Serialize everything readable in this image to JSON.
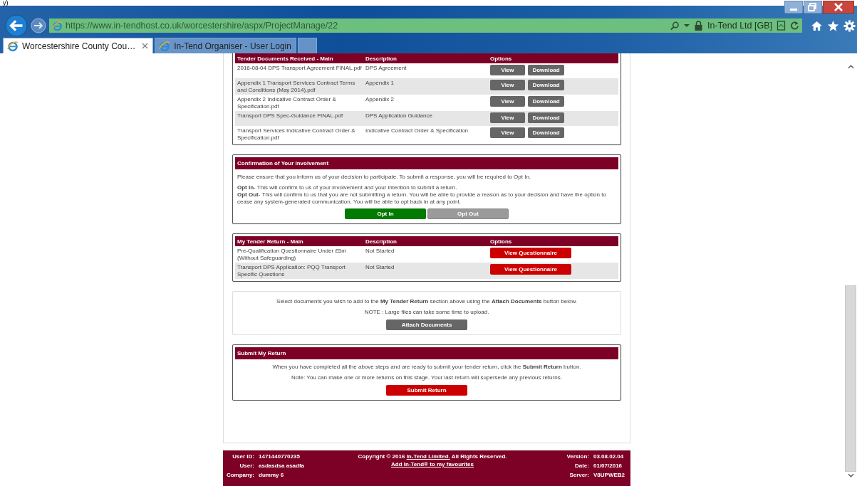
{
  "top_fragment": "y)",
  "browser": {
    "address": "https://www.in-tendhost.co.uk/worcestershire/aspx/ProjectManage/22",
    "site_identity": "In-Tend Ltd [GB]",
    "tabs": [
      {
        "title": "Worcestershire County Cou…",
        "selected": true
      },
      {
        "title": "In-Tend Organiser - User Login",
        "selected": false
      }
    ]
  },
  "documents": {
    "columns": [
      "Tender Documents Received - Main",
      "Description",
      "Options"
    ],
    "rows": [
      {
        "name": "2016-08-04 DPS Transport Agreement FINAL.pdf",
        "description": "DPS Agreement",
        "actions": [
          "View",
          "Download"
        ]
      },
      {
        "name": "Appendix 1 Transport Services Contract Terms and Conditions (May 2014).pdf",
        "description": "Appendix 1",
        "actions": [
          "View",
          "Download"
        ]
      },
      {
        "name": "Appendix 2 Indicative Contract Order & Specification.pdf",
        "description": "Appendix 2",
        "actions": [
          "View",
          "Download"
        ]
      },
      {
        "name": "Transport DPS Spec-Guidance FINAL.pdf",
        "description": "DPS Application Guidance",
        "actions": [
          "View",
          "Download"
        ]
      },
      {
        "name": "Transport Services Indicative Contract Order & Specification.pdf",
        "description": "Indicative Contract Order & Specification",
        "actions": [
          "View",
          "Download"
        ]
      }
    ]
  },
  "confirmation": {
    "title": "Confirmation of Your Involvement",
    "intro": "Please ensure that you inform us of your decision to participate. To submit a response, you will be required to Opt In.",
    "details": [
      "**Opt In**- This will confirm to us of your involvement and your intention to submit a return.",
      "**Opt Out**- This will confirm to us that you are not submitting a return. You will be able to provide a reason as to your decision and have the option to cease any system-generated communication. You will be able to opt back in at any point."
    ],
    "buttons": [
      {
        "label": "Opt In",
        "disabled": false
      },
      {
        "label": "Opt Out",
        "disabled": true
      }
    ]
  },
  "returns": {
    "columns": [
      "My Tender Return - Main",
      "Description",
      "Options"
    ],
    "rows": [
      {
        "name": "Pre-Qualification Questionnaire Under £5m (Without Safeguarding)",
        "status": "Not Started",
        "action": "View Questionnaire"
      },
      {
        "name": "Transport DPS Application: PQQ Transport Specific Questions",
        "status": "Not Started",
        "action": "View Questionnaire"
      }
    ]
  },
  "attach": {
    "text": "Select documents you wish to add to the **My Tender Return** section above using the **Attach Documents** button below.",
    "note": "NOTE : Large files can take some time to upload.",
    "button": "Attach Documents"
  },
  "submit": {
    "title": "Submit My Return",
    "text": "When you have completed all the above steps and are ready to submit your tender return, click the **Submit Return** button.",
    "note": "Note: You can make one or more returns on this stage. Your last return will supersede any previous returns.",
    "button": "Submit Return"
  },
  "footer": {
    "left": [
      {
        "label": "User ID:",
        "value": "1471440770235"
      },
      {
        "label": "User:",
        "value": "asdasdsa asadfa"
      },
      {
        "label": "Company:",
        "value": "dummy 6"
      }
    ],
    "copyright_before": "Copyright © 2016 ",
    "copyright_link": "In-Tend Limited.",
    "copyright_after": " All Rights Reserved.",
    "favourites_link": "Add In-Tend® to my favourites",
    "right": [
      {
        "label": "Version:",
        "value": "03.08.02.04"
      },
      {
        "label": "Date:",
        "value": "01/07/2016"
      },
      {
        "label": "Server:",
        "value": "V8UPWEB2"
      }
    ]
  }
}
